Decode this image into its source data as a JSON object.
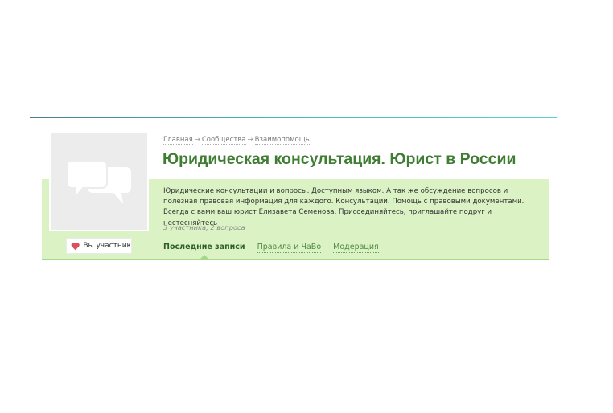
{
  "breadcrumb": {
    "items": [
      "Главная",
      "Сообщества",
      "Взаимопомощь"
    ],
    "separator": "→"
  },
  "community": {
    "title": "Юридическая консультация. Юрист в России",
    "description": "Юридические консультации и вопросы. Доступным языком. А так же обсуждение вопросов и полезная правовая информация для каждого. Консультации. Помощь с правовыми документами. Всегда с вами ваш юрист Елизавета Семенова. Присоединяйтесь, приглашайте подруг и нестесняйтесь",
    "stats": "3 участника, 2 вопроса",
    "avatar_icon": "chat-bubbles-icon"
  },
  "membership": {
    "label": "Вы участник",
    "icon": "heart-icon",
    "icon_color": "#d94f5c"
  },
  "tabs": [
    {
      "label": "Последние записи",
      "active": true
    },
    {
      "label": "Правила и ЧаВо",
      "active": false
    },
    {
      "label": "Модерация",
      "active": false
    }
  ],
  "colors": {
    "accent_green": "#3f7d33",
    "card_background": "#dbf2c4",
    "top_rule": "#3fb8bb"
  }
}
